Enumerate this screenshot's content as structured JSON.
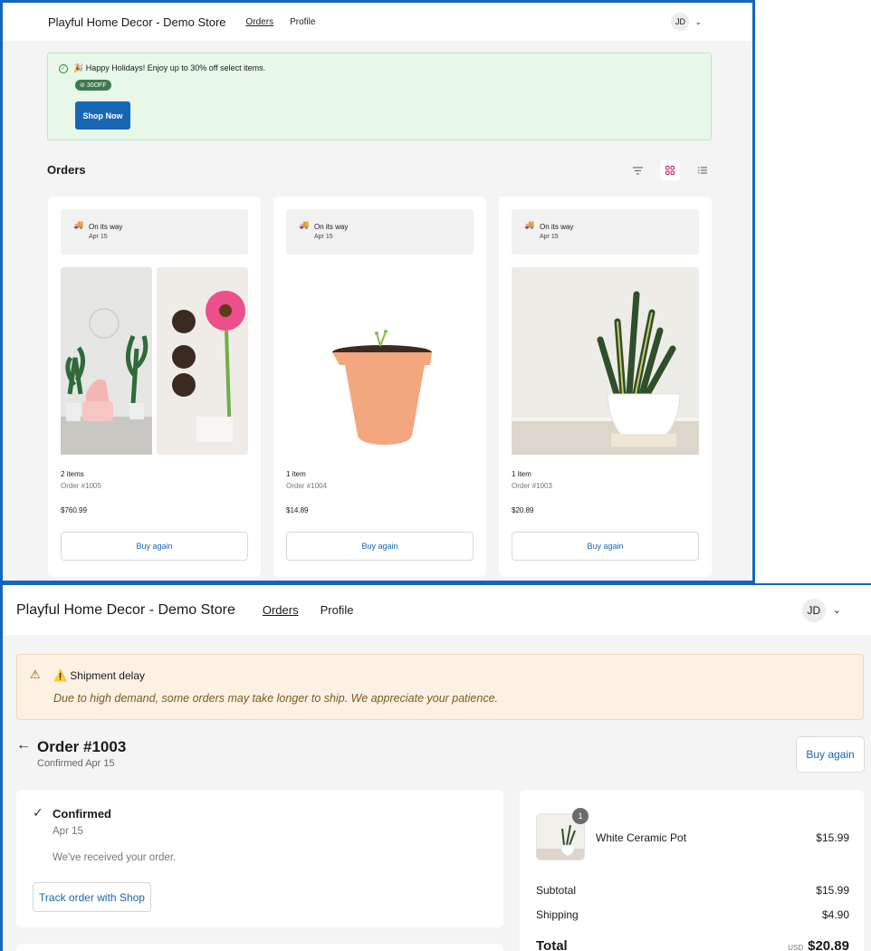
{
  "screen1": {
    "header": {
      "store_name": "Playful Home Decor - Demo Store",
      "nav": [
        "Orders",
        "Profile"
      ],
      "avatar": "JD",
      "chevron": "⌄"
    },
    "promo": {
      "message": "🎉 Happy Holidays! Enjoy up to 30% off select items.",
      "code": "30OFF",
      "button": "Shop Now"
    },
    "orders_title": "Orders",
    "icons": [
      "check-circle-icon",
      "tag-icon",
      "filter-icon",
      "grid-view-icon",
      "list-view-icon",
      "truck-icon"
    ],
    "orders": [
      {
        "status": "On its way",
        "date": "Apr 15",
        "items": "2 items",
        "number": "Order #1005",
        "price": "$760.99",
        "button": "Buy again"
      },
      {
        "status": "On its way",
        "date": "Apr 15",
        "items": "1 item",
        "number": "Order #1004",
        "price": "$14.89",
        "button": "Buy again"
      },
      {
        "status": "On its way",
        "date": "Apr 15",
        "items": "1 item",
        "number": "Order #1003",
        "price": "$20.89",
        "button": "Buy again"
      }
    ]
  },
  "screen2": {
    "header": {
      "store_name": "Playful Home Decor - Demo Store",
      "nav": [
        "Orders",
        "Profile"
      ],
      "avatar": "JD",
      "chevron": "⌄"
    },
    "alert": {
      "title": "⚠️ Shipment delay",
      "message": "Due to high demand, some orders may take longer to ship. We appreciate your patience."
    },
    "order": {
      "title": "Order #1003",
      "subtitle": "Confirmed Apr 15",
      "buy_again": "Buy again"
    },
    "status": {
      "title": "Confirmed",
      "date": "Apr 15",
      "message": "We've received your order.",
      "track_button": "Track order with Shop"
    },
    "summary": {
      "item": {
        "name": "White Ceramic Pot",
        "price": "$15.99",
        "qty": "1"
      },
      "subtotal_label": "Subtotal",
      "subtotal": "$15.99",
      "shipping_label": "Shipping",
      "shipping": "$4.90",
      "total_label": "Total",
      "currency": "USD",
      "total": "$20.89"
    },
    "colors": {
      "accent": "#1766b3",
      "promo_bg": "#e7f8e8",
      "alert_bg": "#fdf1e4",
      "border": "#1565c0"
    }
  }
}
